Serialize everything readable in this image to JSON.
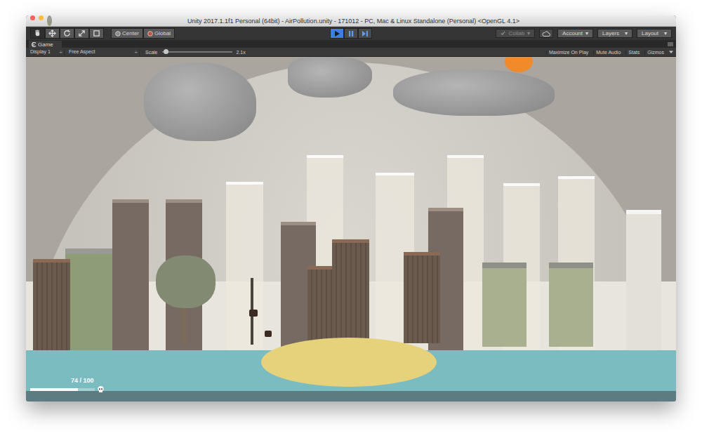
{
  "window": {
    "title": "Unity 2017.1.1f1 Personal (64bit) - AirPollution.unity - 171012 - PC, Mac & Linux Standalone (Personal) <OpenGL 4.1>"
  },
  "tools": [
    {
      "kind": "hand",
      "selected": true
    },
    {
      "kind": "move",
      "selected": false
    },
    {
      "kind": "rotate",
      "selected": false
    },
    {
      "kind": "scale",
      "selected": false
    },
    {
      "kind": "rect",
      "selected": false
    }
  ],
  "pivot_buttons": [
    {
      "label": "Center"
    },
    {
      "label": "Global"
    }
  ],
  "play_controls": [
    {
      "kind": "play",
      "selected": true
    },
    {
      "kind": "pause",
      "selected": false
    },
    {
      "kind": "step",
      "selected": false
    }
  ],
  "collab": {
    "label": "Collab",
    "arrow": "▾",
    "disabled": true
  },
  "menus": [
    {
      "label": "Account",
      "arrow": "▾"
    },
    {
      "label": "Layers",
      "arrow": "▾"
    },
    {
      "label": "Layout",
      "arrow": "▾"
    }
  ],
  "tab": {
    "label": "Game"
  },
  "game_bar": {
    "display": {
      "label": "Display 1",
      "arrow": "÷"
    },
    "aspect": {
      "label": "Free Aspect",
      "arrow": "÷"
    },
    "scale": {
      "label": "Scale",
      "value": "2.1x",
      "level": 0.05
    },
    "toggles": [
      {
        "label": "Maximize On Play",
        "on": false
      },
      {
        "label": "Mute Audio",
        "on": false
      },
      {
        "label": "Stats",
        "on": false
      },
      {
        "label": "Gizmos",
        "on": false
      }
    ]
  },
  "hud": {
    "reading": "74 / 100",
    "level": 0.74
  }
}
